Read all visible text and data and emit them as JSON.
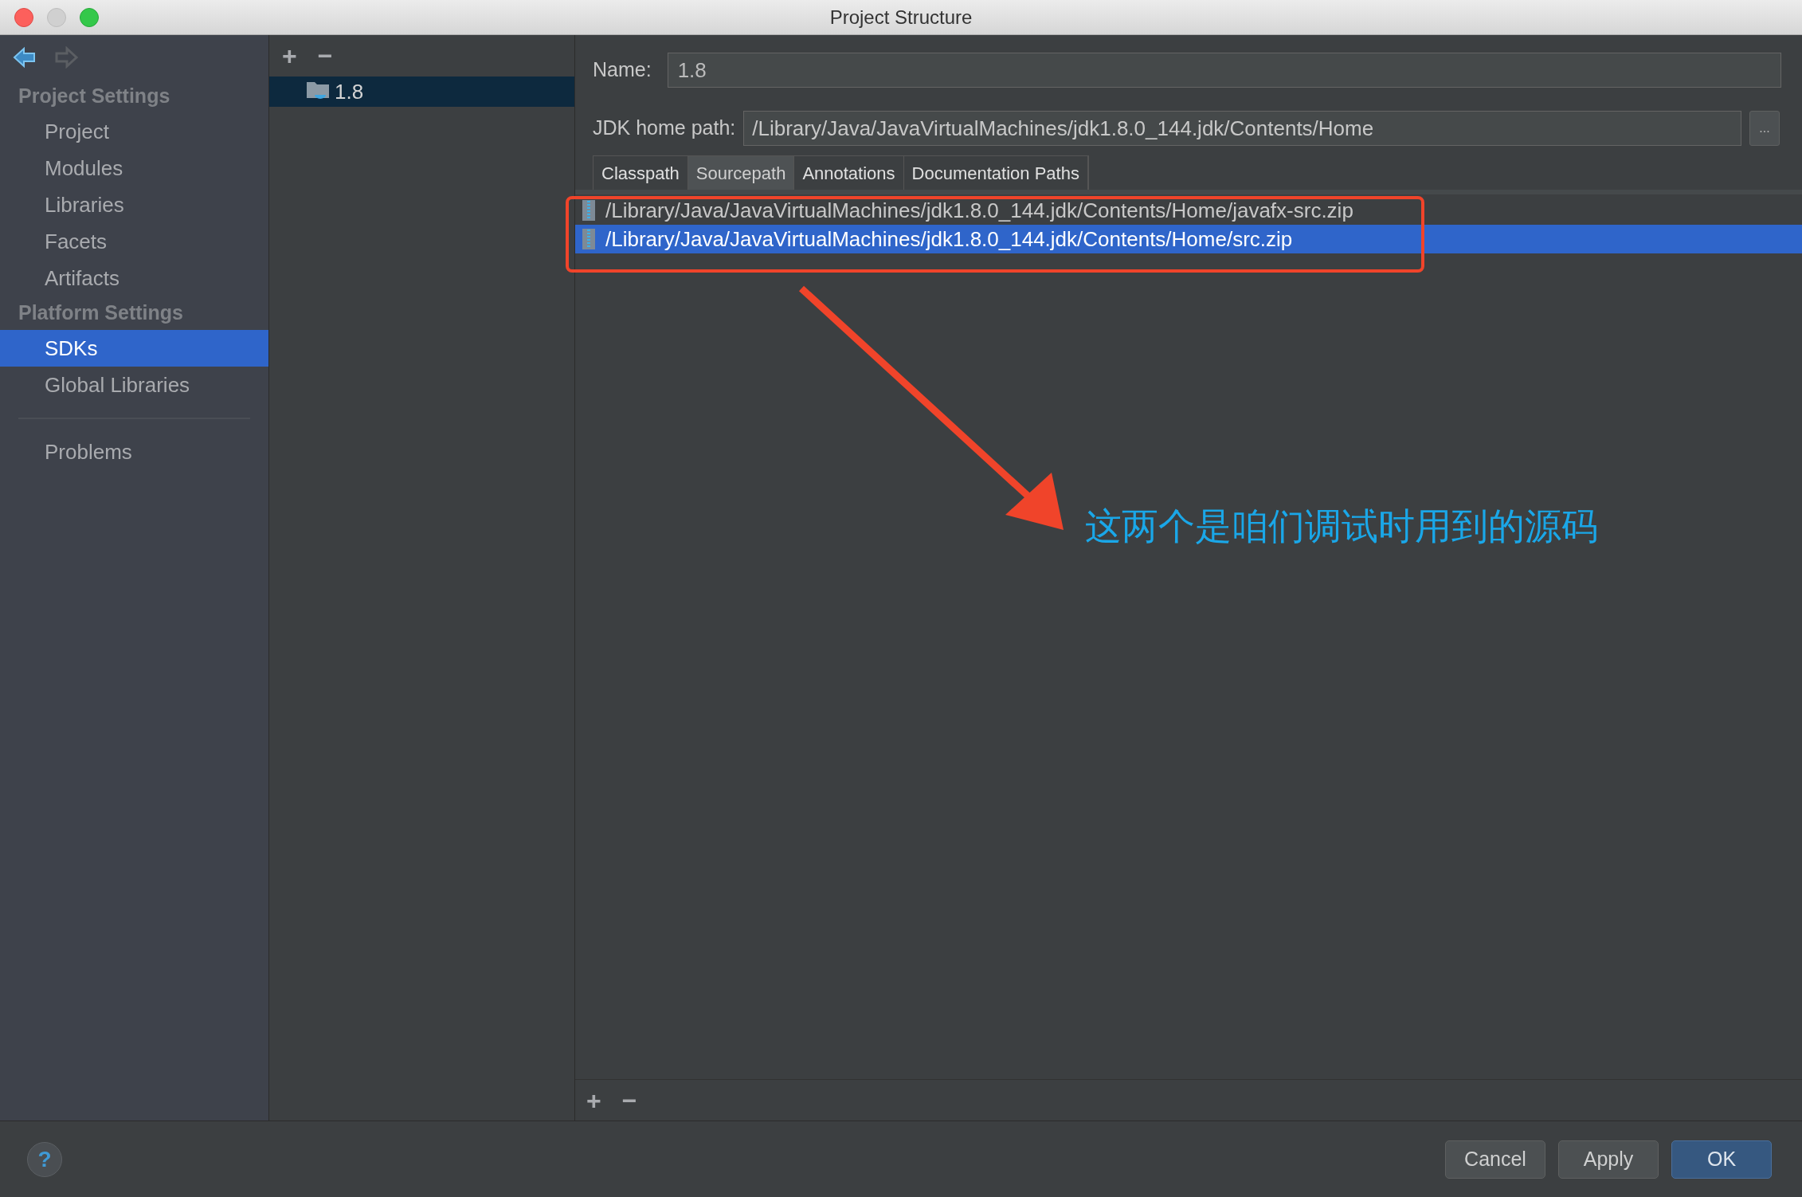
{
  "window": {
    "title": "Project Structure"
  },
  "sidebar": {
    "sections": [
      {
        "title": "Project Settings",
        "items": [
          {
            "label": "Project",
            "selected": false
          },
          {
            "label": "Modules",
            "selected": false
          },
          {
            "label": "Libraries",
            "selected": false
          },
          {
            "label": "Facets",
            "selected": false
          },
          {
            "label": "Artifacts",
            "selected": false
          }
        ]
      },
      {
        "title": "Platform Settings",
        "items": [
          {
            "label": "SDKs",
            "selected": true
          },
          {
            "label": "Global Libraries",
            "selected": false
          }
        ]
      }
    ],
    "problems": "Problems"
  },
  "sdk_toolbar": [
    "+",
    "−"
  ],
  "sdk_list": [
    {
      "label": "1.8",
      "selected": true
    }
  ],
  "form": {
    "name_label": "Name:",
    "name": "1.8",
    "home_label": "JDK home path:",
    "home": "/Library/Java/JavaVirtualMachines/jdk1.8.0_144.jdk/Contents/Home",
    "browse": "..."
  },
  "tabs": [
    {
      "label": "Classpath",
      "selected": false
    },
    {
      "label": "Sourcepath",
      "selected": true
    },
    {
      "label": "Annotations",
      "selected": false
    },
    {
      "label": "Documentation Paths",
      "selected": false
    }
  ],
  "paths": [
    {
      "path": "/Library/Java/JavaVirtualMachines/jdk1.8.0_144.jdk/Contents/Home/javafx-src.zip",
      "selected": false
    },
    {
      "path": "/Library/Java/JavaVirtualMachines/jdk1.8.0_144.jdk/Contents/Home/src.zip",
      "selected": true
    }
  ],
  "paths_toolbar": [
    "+",
    "−"
  ],
  "annotation": {
    "text": "这两个是咱们调试时用到的源码"
  },
  "help": "?",
  "buttons": [
    {
      "label": "Cancel",
      "kind": "normal"
    },
    {
      "label": "Apply",
      "kind": "normal"
    },
    {
      "label": "OK",
      "kind": "default"
    }
  ]
}
